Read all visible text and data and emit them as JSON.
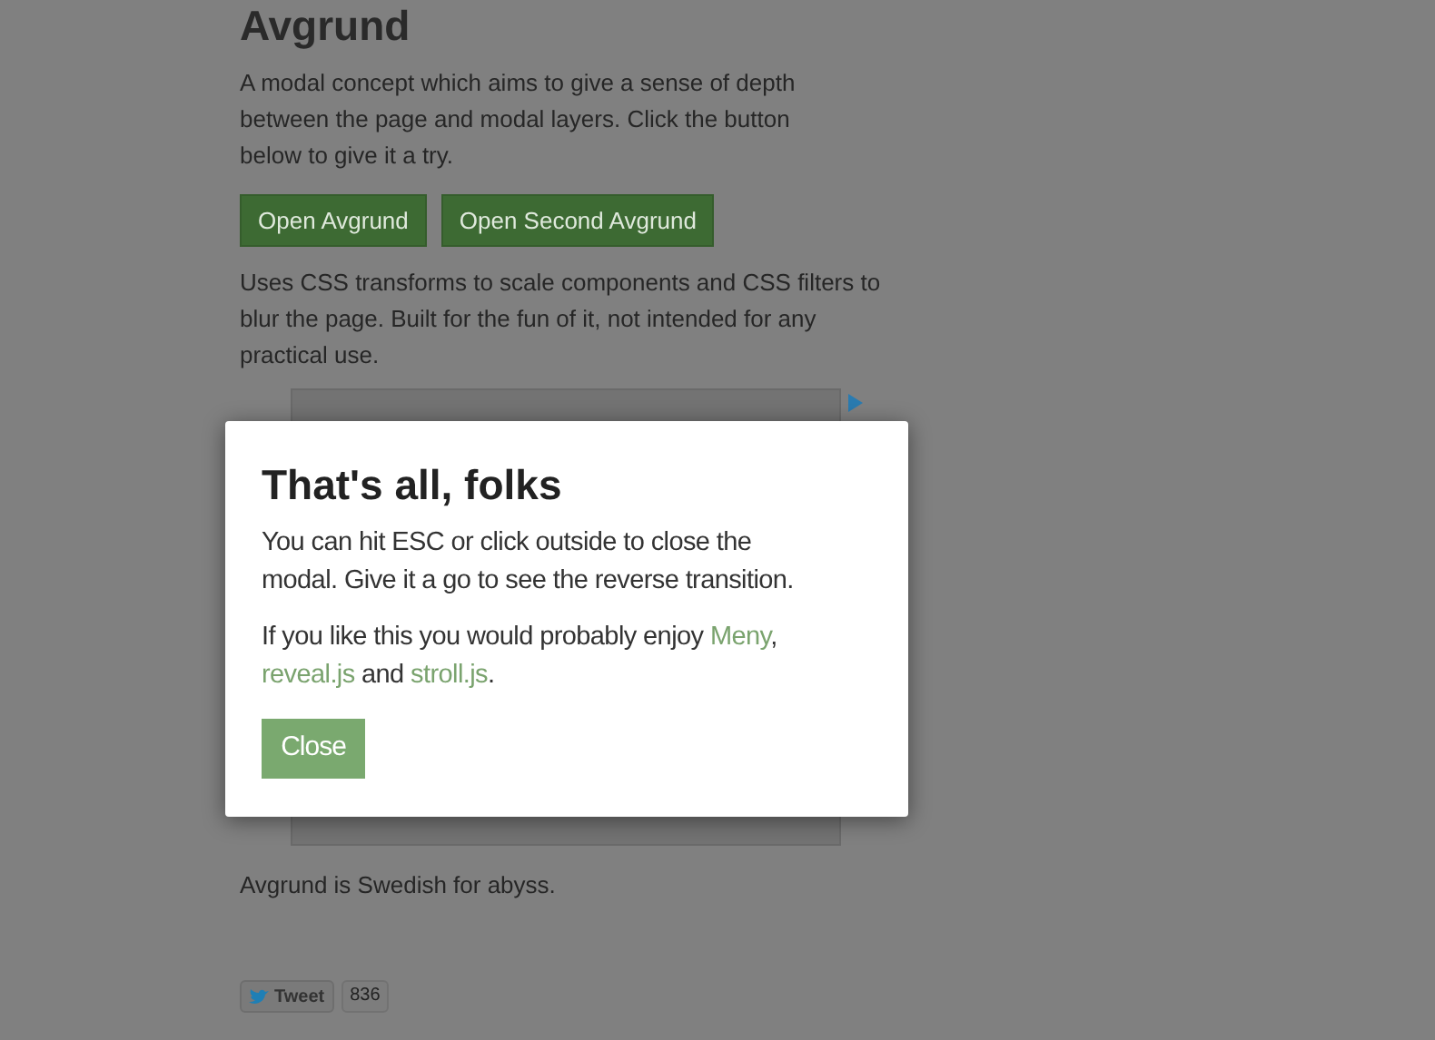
{
  "page": {
    "title": "Avgrund",
    "intro": "A modal concept which aims to give a sense of depth between the page and modal layers. Click the button below to give it a try.",
    "buttons": [
      "Open Avgrund",
      "Open Second Avgrund"
    ],
    "description": "Uses CSS transforms to scale components and CSS filters to blur the page. Built for the fun of it, not intended for any practical use.",
    "footnote": "Avgrund is Swedish for abyss.",
    "tweet": {
      "label": "Tweet",
      "count": "836"
    }
  },
  "modal": {
    "title": "That's all, folks",
    "text": "You can hit ESC or click outside to close the modal. Give it a go to see the reverse transition.",
    "parts": [
      {
        "kind": "text",
        "text": "If you like this you would probably enjoy "
      },
      {
        "kind": "link",
        "text": "Meny"
      },
      {
        "kind": "text",
        "text": ", "
      },
      {
        "kind": "link",
        "text": "reveal.js"
      },
      {
        "kind": "text",
        "text": " and "
      },
      {
        "kind": "link",
        "text": "stroll.js"
      },
      {
        "kind": "text",
        "text": "."
      }
    ],
    "button": "Close"
  }
}
